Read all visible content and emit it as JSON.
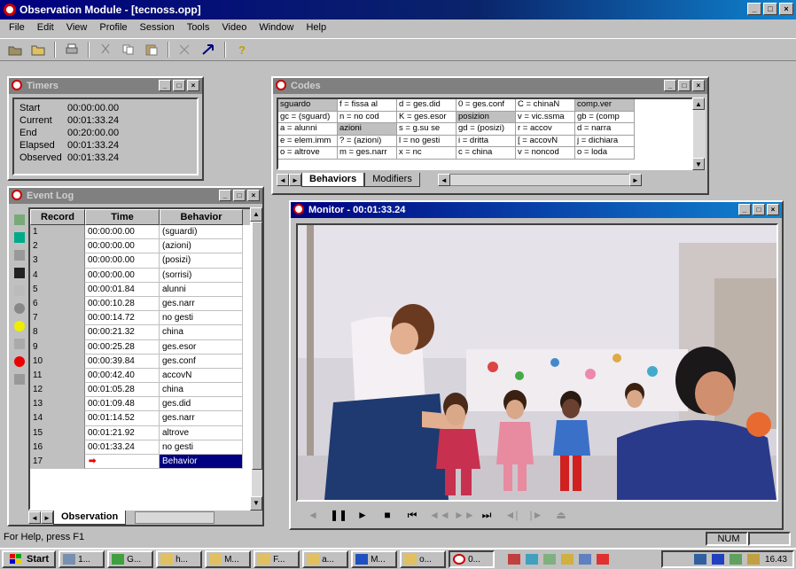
{
  "app": {
    "title": "Observation Module - [tecnoss.opp]",
    "window_buttons": [
      "_",
      "□",
      "×"
    ]
  },
  "menu": [
    "File",
    "Edit",
    "View",
    "Profile",
    "Session",
    "Tools",
    "Video",
    "Window",
    "Help"
  ],
  "toolbar": {
    "buttons": [
      "open-icon",
      "folder-icon",
      "print-icon",
      "cut-icon",
      "copy-icon",
      "paste-icon",
      "scissor-tool-icon",
      "arrow-tool-icon",
      "help-icon"
    ]
  },
  "timers": {
    "title": "Timers",
    "rows": [
      {
        "label": "Start",
        "value": "00:00:00.00"
      },
      {
        "label": "Current",
        "value": "00:01:33.24"
      },
      {
        "label": "End",
        "value": "00:20:00.00"
      },
      {
        "label": "Elapsed",
        "value": "00:01:33.24"
      },
      {
        "label": "Observed",
        "value": "00:01:33.24"
      }
    ]
  },
  "event_log": {
    "title": "Event Log",
    "columns": [
      "Record",
      "Time",
      "Behavior"
    ],
    "rows": [
      {
        "record": "1",
        "time": "00:00:00.00",
        "behavior": "(sguardi)"
      },
      {
        "record": "2",
        "time": "00:00:00.00",
        "behavior": "(azioni)"
      },
      {
        "record": "3",
        "time": "00:00:00.00",
        "behavior": "(posizi)"
      },
      {
        "record": "4",
        "time": "00:00:00.00",
        "behavior": "(sorrisi)"
      },
      {
        "record": "5",
        "time": "00:00:01.84",
        "behavior": "alunni"
      },
      {
        "record": "6",
        "time": "00:00:10.28",
        "behavior": "ges.narr"
      },
      {
        "record": "7",
        "time": "00:00:14.72",
        "behavior": "no gesti"
      },
      {
        "record": "8",
        "time": "00:00:21.32",
        "behavior": "china"
      },
      {
        "record": "9",
        "time": "00:00:25.28",
        "behavior": "ges.esor"
      },
      {
        "record": "10",
        "time": "00:00:39.84",
        "behavior": "ges.conf"
      },
      {
        "record": "11",
        "time": "00:00:42.40",
        "behavior": "accovN"
      },
      {
        "record": "12",
        "time": "00:01:05.28",
        "behavior": "china"
      },
      {
        "record": "13",
        "time": "00:01:09.48",
        "behavior": "ges.did"
      },
      {
        "record": "14",
        "time": "00:01:14.52",
        "behavior": "ges.narr"
      },
      {
        "record": "15",
        "time": "00:01:21.92",
        "behavior": "altrove"
      },
      {
        "record": "16",
        "time": "00:01:33.24",
        "behavior": "no gesti"
      },
      {
        "record": "17",
        "time": "",
        "behavior": "Behavior"
      }
    ],
    "tabs": [
      "Observation"
    ]
  },
  "codes": {
    "title": "Codes",
    "rows": [
      [
        "sguardo",
        "f = fissa al",
        "d = ges.did",
        "0 = ges.conf",
        "C = chinaN",
        "comp.ver"
      ],
      [
        "gc = (sguard)",
        "n = no cod",
        "K = ges.esor",
        "posizion",
        "v = vic.ssma",
        "gb = (comp"
      ],
      [
        "a = alunni",
        "azioni",
        "s = g.su se",
        "gd = (posizi)",
        "r = accov",
        "d = narra"
      ],
      [
        "e = elem.imm",
        "? = (azioni)",
        "l = no gesti",
        "i = dritta",
        "[ = accovN",
        "j = dichiara"
      ],
      [
        "o = altrove",
        "m = ges.narr",
        "x = nc",
        "c = china",
        "v = noncod",
        "o = loda"
      ]
    ],
    "highlight_cells": [
      "sguardo",
      "azioni",
      "posizion",
      "comp.ver"
    ],
    "tabs": [
      "Behaviors",
      "Modifiers"
    ]
  },
  "monitor": {
    "title": "Monitor - 00:01:33.24",
    "transport": [
      "◄",
      "❚❚",
      "►",
      "■",
      "⏮",
      "◄◄",
      "►►",
      "⏭",
      "◄|",
      "|►",
      "⏏"
    ]
  },
  "status": {
    "help": "For Help, press F1",
    "num": "NUM"
  },
  "taskbar": {
    "start": "Start",
    "tasks": [
      "1...",
      "G...",
      "h...",
      "M...",
      "F...",
      "a...",
      "M...",
      "o...",
      "0..."
    ],
    "clock": "16.43"
  }
}
